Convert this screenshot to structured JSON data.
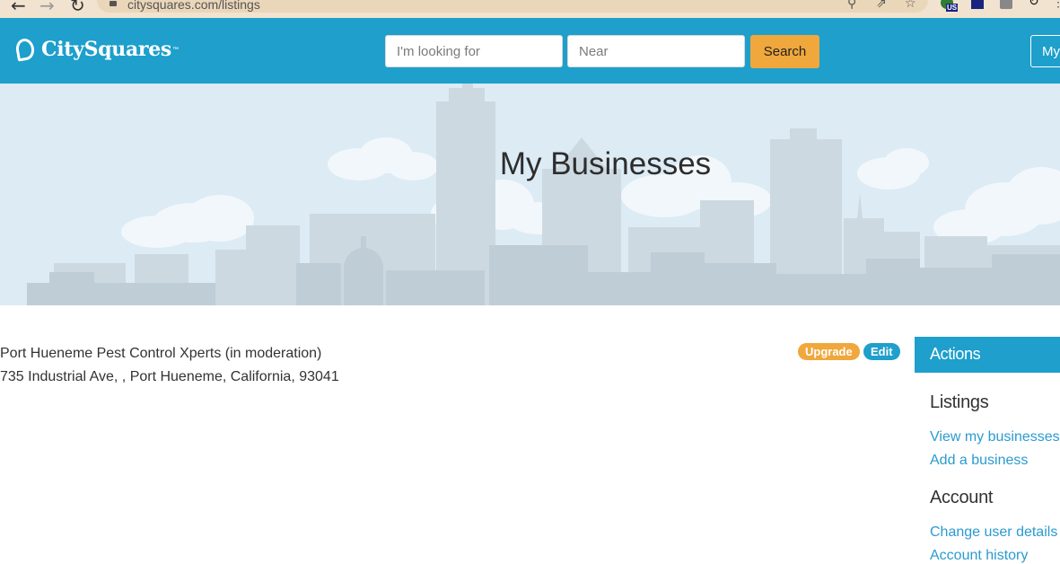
{
  "browser": {
    "url": "citysquares.com/listings",
    "extension_badge": "US"
  },
  "header": {
    "logo_text": "CitySquares",
    "logo_tm": "™",
    "search_what_placeholder": "I'm looking for",
    "search_near_placeholder": "Near",
    "search_button": "Search",
    "account_button": "My"
  },
  "hero": {
    "title": "My Businesses"
  },
  "listing": {
    "name": "Port Hueneme Pest Control Xperts (in moderation)",
    "address": "735 Industrial Ave, , Port Hueneme, California, 93041",
    "upgrade_label": "Upgrade",
    "edit_label": "Edit"
  },
  "sidebar": {
    "actions_title": "Actions",
    "listings_heading": "Listings",
    "listings_links": [
      "View my businesses",
      "Add a business"
    ],
    "account_heading": "Account",
    "account_links": [
      "Change user details",
      "Account history"
    ]
  },
  "colors": {
    "brand_blue": "#1e9fcc",
    "accent_orange": "#f0a73c",
    "link_blue": "#2a9bd0",
    "hero_bg": "#dcebf4"
  }
}
